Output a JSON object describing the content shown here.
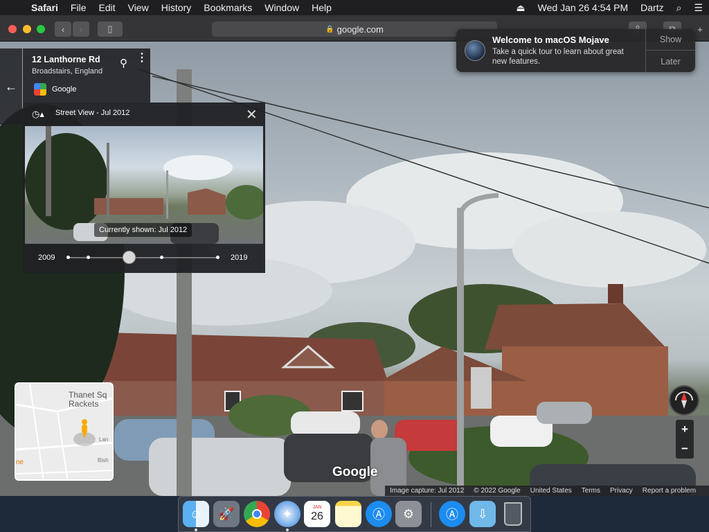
{
  "menubar": {
    "app": "Safari",
    "items": [
      "File",
      "Edit",
      "View",
      "History",
      "Bookmarks",
      "Window",
      "Help"
    ],
    "datetime": "Wed Jan 26  4:54 PM",
    "user": "Dartz"
  },
  "toolbar": {
    "url": "google.com"
  },
  "notification": {
    "title": "Welcome to macOS Mojave",
    "body": "Take a quick tour to learn about great new features.",
    "show": "Show",
    "later": "Later"
  },
  "address": {
    "street": "12 Lanthorne Rd",
    "city": "Broadstairs, England",
    "source": "Google"
  },
  "timeline": {
    "header": "Street View - Jul 2012",
    "caption": "Currently shown: Jul 2012",
    "start_year": "2009",
    "end_year": "2019"
  },
  "minimap": {
    "label": "Thanet Sq Rackets",
    "road1": "Lan",
    "road2": "Bish",
    "partial": "ne"
  },
  "watermark": "Google",
  "footer": {
    "capture": "Image capture: Jul 2012",
    "copyright": "© 2022 Google",
    "region": "United States",
    "terms": "Terms",
    "privacy": "Privacy",
    "report": "Report a problem"
  },
  "dock": {
    "calendar_day": "26",
    "calendar_month": "JAN"
  }
}
